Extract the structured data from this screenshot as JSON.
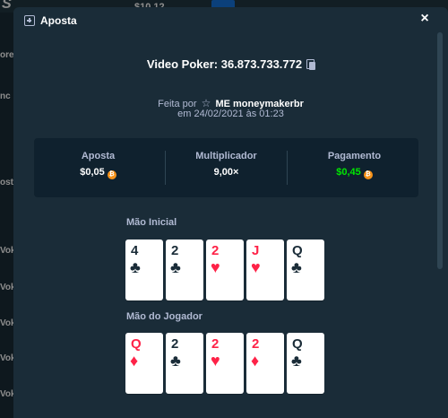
{
  "background": {
    "balance": "$10,12",
    "sidebar_items": [
      "ore",
      "nc",
      "osta",
      "Voke",
      "Voke",
      "Voke",
      "Voke",
      "Voke"
    ]
  },
  "modal": {
    "title": "Aposta",
    "close_label": "×",
    "game_title": "Video Poker: 36.873.733.772",
    "made_by_prefix": "Feita por",
    "rank_badge": "☆",
    "user": "ME moneymakerbr",
    "date": "em 24/02/2021 às 01:23"
  },
  "stats": [
    {
      "label": "Aposta",
      "value": "$0,05",
      "coin": true,
      "color": "#ffffff"
    },
    {
      "label": "Multiplicador",
      "value": "9,00×",
      "coin": false,
      "color": "#ffffff"
    },
    {
      "label": "Pagamento",
      "value": "$0,45",
      "coin": true,
      "color": "#00e701"
    }
  ],
  "hands": [
    {
      "label": "Mão Inicial",
      "cards": [
        {
          "rank": "4",
          "suit": "♣",
          "color": "black"
        },
        {
          "rank": "2",
          "suit": "♣",
          "color": "black"
        },
        {
          "rank": "2",
          "suit": "♥",
          "color": "red"
        },
        {
          "rank": "J",
          "suit": "♥",
          "color": "red"
        },
        {
          "rank": "Q",
          "suit": "♣",
          "color": "black"
        }
      ]
    },
    {
      "label": "Mão do Jogador",
      "cards": [
        {
          "rank": "Q",
          "suit": "♦",
          "color": "red"
        },
        {
          "rank": "2",
          "suit": "♣",
          "color": "black"
        },
        {
          "rank": "2",
          "suit": "♥",
          "color": "red"
        },
        {
          "rank": "2",
          "suit": "♦",
          "color": "red"
        },
        {
          "rank": "Q",
          "suit": "♣",
          "color": "black"
        }
      ]
    }
  ]
}
